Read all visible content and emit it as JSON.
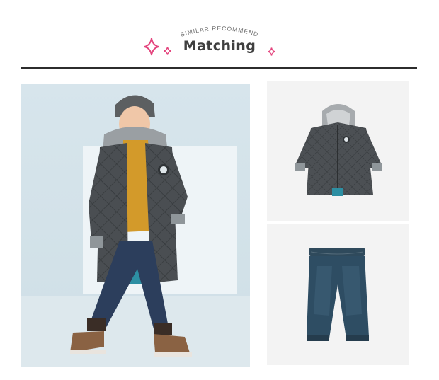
{
  "header": {
    "subtitle": "SIMILAR  RECOMMEND",
    "title": "Matching",
    "accent_color": "#e4457e"
  },
  "images": {
    "main": {
      "label": "boy-wearing-coat-and-jeans",
      "icon": "model-photo"
    },
    "coat": {
      "label": "quilted-grey-hooded-coat",
      "icon": "coat-product"
    },
    "jeans": {
      "label": "dark-denim-jeans",
      "icon": "jeans-product"
    }
  }
}
